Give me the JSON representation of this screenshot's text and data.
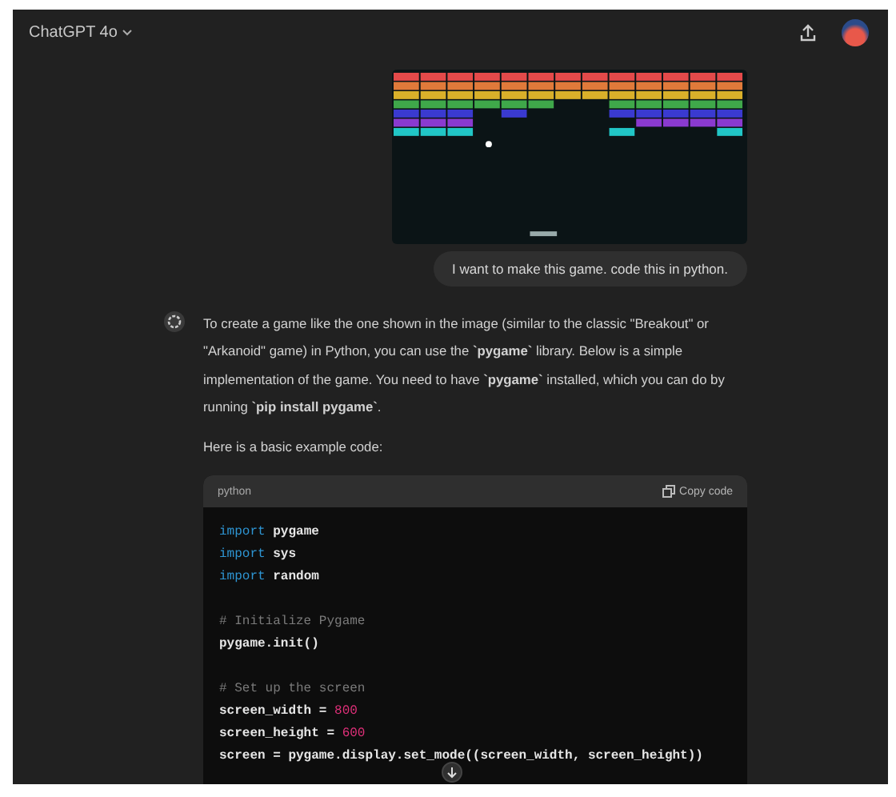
{
  "header": {
    "model": "ChatGPT 4o"
  },
  "attachment": {
    "kind": "game_screenshot"
  },
  "user_message": "I want to make this game. code this in python.",
  "assistant": {
    "paragraphs": [
      "To create a game like the one shown in the image (similar to the classic \"Breakout\" or \"Arkanoid\" game) in Python, you can use the **`pygame`** library. Below is a simple implementation of the game. You need to have **`pygame`** installed, which you can do by running **`pip install pygame`**.",
      "Here is a basic example code:"
    ],
    "code_block": {
      "language": "python",
      "copy_label": "Copy code",
      "sections": [
        [
          [
            {
              "kind": "keyword",
              "text": "import"
            },
            {
              "kind": "plain",
              "text": " pygame"
            }
          ],
          [
            {
              "kind": "keyword",
              "text": "import"
            },
            {
              "kind": "plain",
              "text": " sys"
            }
          ],
          [
            {
              "kind": "keyword",
              "text": "import"
            },
            {
              "kind": "plain",
              "text": " random"
            }
          ]
        ],
        [
          [
            {
              "kind": "comment",
              "text": "# Initialize Pygame"
            }
          ],
          [
            {
              "kind": "plain",
              "text": "pygame.init()"
            }
          ]
        ],
        [
          [
            {
              "kind": "comment",
              "text": "# Set up the screen"
            }
          ],
          [
            {
              "kind": "plain",
              "text": "screen_width = "
            },
            {
              "kind": "number",
              "text": "800"
            }
          ],
          [
            {
              "kind": "plain",
              "text": "screen_height = "
            },
            {
              "kind": "number",
              "text": "600"
            }
          ],
          [
            {
              "kind": "plain",
              "text": "screen = pygame.display.set_mode((screen_width, screen_height))"
            }
          ]
        ]
      ]
    }
  }
}
